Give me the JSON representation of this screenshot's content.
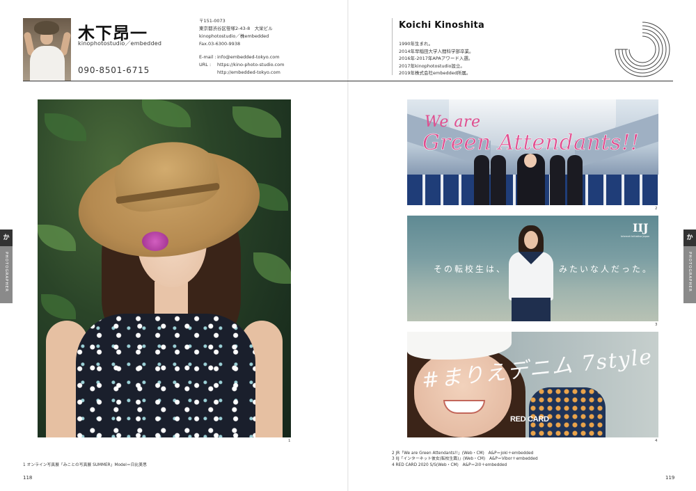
{
  "profile": {
    "name_jp": "木下昂一",
    "studio": "kinophotostudio／embedded",
    "phone": "090-8501-6715",
    "address_lines": [
      "〒151-0073",
      "東京都渋谷区笹塚2-43-8　大栄ビル",
      "kinophotostudio／株embedded",
      "Fax.03-6300-9938"
    ],
    "email_label": "E-mail :",
    "email": "info@embedded-tokyo.com",
    "url_label": "URL :",
    "urls": [
      "https://kino-photo-studio.com",
      "http://embedded-tokyo.com"
    ],
    "name_en": "Koichi Kinoshita",
    "bio": [
      "1990年生まれ。",
      "2014年早稲田大学人間科学部卒業。",
      "2016年-2017年APAアワード入選。",
      "2017年kinophotostudio設立。",
      "2019年株式会社embedded所属。"
    ]
  },
  "figures": {
    "fig1_number": "1",
    "fig2_number": "2",
    "fig3_number": "3",
    "fig4_number": "4",
    "fig2_text_line1": "We are",
    "fig2_text_line2": "Green Attendants!!",
    "fig3_logo": "IIJ",
    "fig3_logo_sub": "Internet Initiative Japan",
    "fig3_copy_left": "その転校生は、",
    "fig3_copy_right": "みたいな人だった。",
    "fig4_script": "#まりえデニム 7style",
    "fig4_brand": "RED CARD"
  },
  "side_tabs": {
    "kana": "か",
    "label": "PHOTOGRAPHER"
  },
  "captions": {
    "left": "1 オンライン写真展「みことの写真展 SUMMER」Model＝日比美思",
    "right": [
      "2 JR「We are Green Attendants!!」(Web・CM)　A&P＝joki＋embedded",
      "3 IIJ「インターネット彼女(転校生篇)」(Web・CM)　A&P＝Vibor＋embedded",
      "4 RED CARD 2020 S/S(Web・CM)　A&P＝2i0＋embedded"
    ]
  },
  "folios": {
    "left": "118",
    "right": "119"
  },
  "colors": {
    "accent_pink": "#e04e8f",
    "tab_dark": "#333333",
    "tab_gray": "#8a8a8a"
  }
}
